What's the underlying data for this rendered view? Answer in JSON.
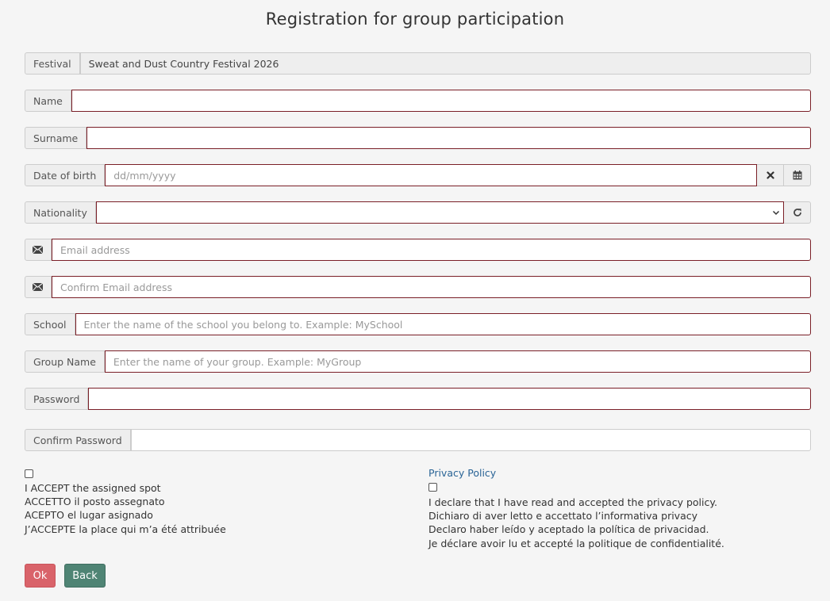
{
  "page": {
    "title": "Registration for group participation"
  },
  "festival": {
    "label": "Festival",
    "value": "Sweat and Dust Country Festival 2026"
  },
  "name": {
    "label": "Name",
    "value": ""
  },
  "surname": {
    "label": "Surname",
    "value": ""
  },
  "dob": {
    "label": "Date of birth",
    "placeholder": "dd/mm/yyyy",
    "clear_icon": "close-icon",
    "calendar_icon": "calendar-icon"
  },
  "nationality": {
    "label": "Nationality",
    "value": "",
    "refresh_icon": "refresh-icon"
  },
  "email": {
    "placeholder": "Email address",
    "icon": "envelope-icon"
  },
  "confirm_email": {
    "placeholder": "Confirm Email address",
    "icon": "envelope-icon"
  },
  "school": {
    "label": "School",
    "placeholder": "Enter the name of the school you belong to. Example: MySchool"
  },
  "group": {
    "label": "Group Name",
    "placeholder": "Enter the name of your group. Example: MyGroup"
  },
  "password": {
    "label": "Password",
    "value": ""
  },
  "confirm_password": {
    "label": "Confirm Password",
    "value": ""
  },
  "accept": {
    "checked": false,
    "lines": [
      "I ACCEPT the assigned spot",
      "ACCETTO il posto assegnato",
      "ACEPTO el lugar asignado",
      "J’ACCEPTE la place qui m’a été attribuée"
    ]
  },
  "privacy": {
    "link": "Privacy Policy",
    "checked": false,
    "lines": [
      "I declare that I have read and accepted the privacy policy.",
      "Dichiaro di aver letto e accettato l’informativa privacy",
      "Declaro haber leído y aceptado la política de privacidad.",
      "Je déclare avoir lu et accepté la politique de confidentialité."
    ]
  },
  "buttons": {
    "ok": "Ok",
    "back": "Back"
  },
  "colors": {
    "invalid_border": "#7a1f27",
    "ok_button": "#d9636a",
    "back_button": "#4f8474",
    "link": "#2a6496"
  }
}
